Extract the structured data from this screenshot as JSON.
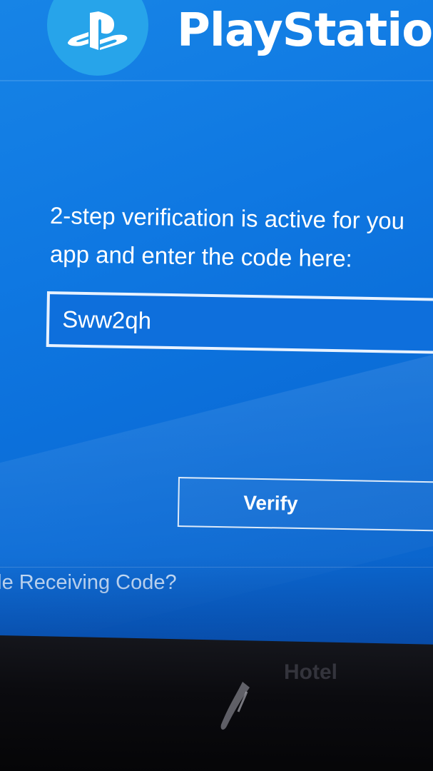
{
  "header": {
    "brand": "PlayStation",
    "logo_icon": "playstation-logo-icon"
  },
  "verification": {
    "message_line1": "2-step verification is active for you",
    "message_line2": "app and enter the code here:",
    "code_value": "Sww2qh",
    "verify_label": "Verify",
    "trouble_link": "ole Receiving Code?"
  },
  "colors": {
    "panel_blue": "#0f78e2",
    "logo_circle": "#27a4ea",
    "text": "#ffffff"
  },
  "bezel": {
    "label": "Hotel"
  }
}
